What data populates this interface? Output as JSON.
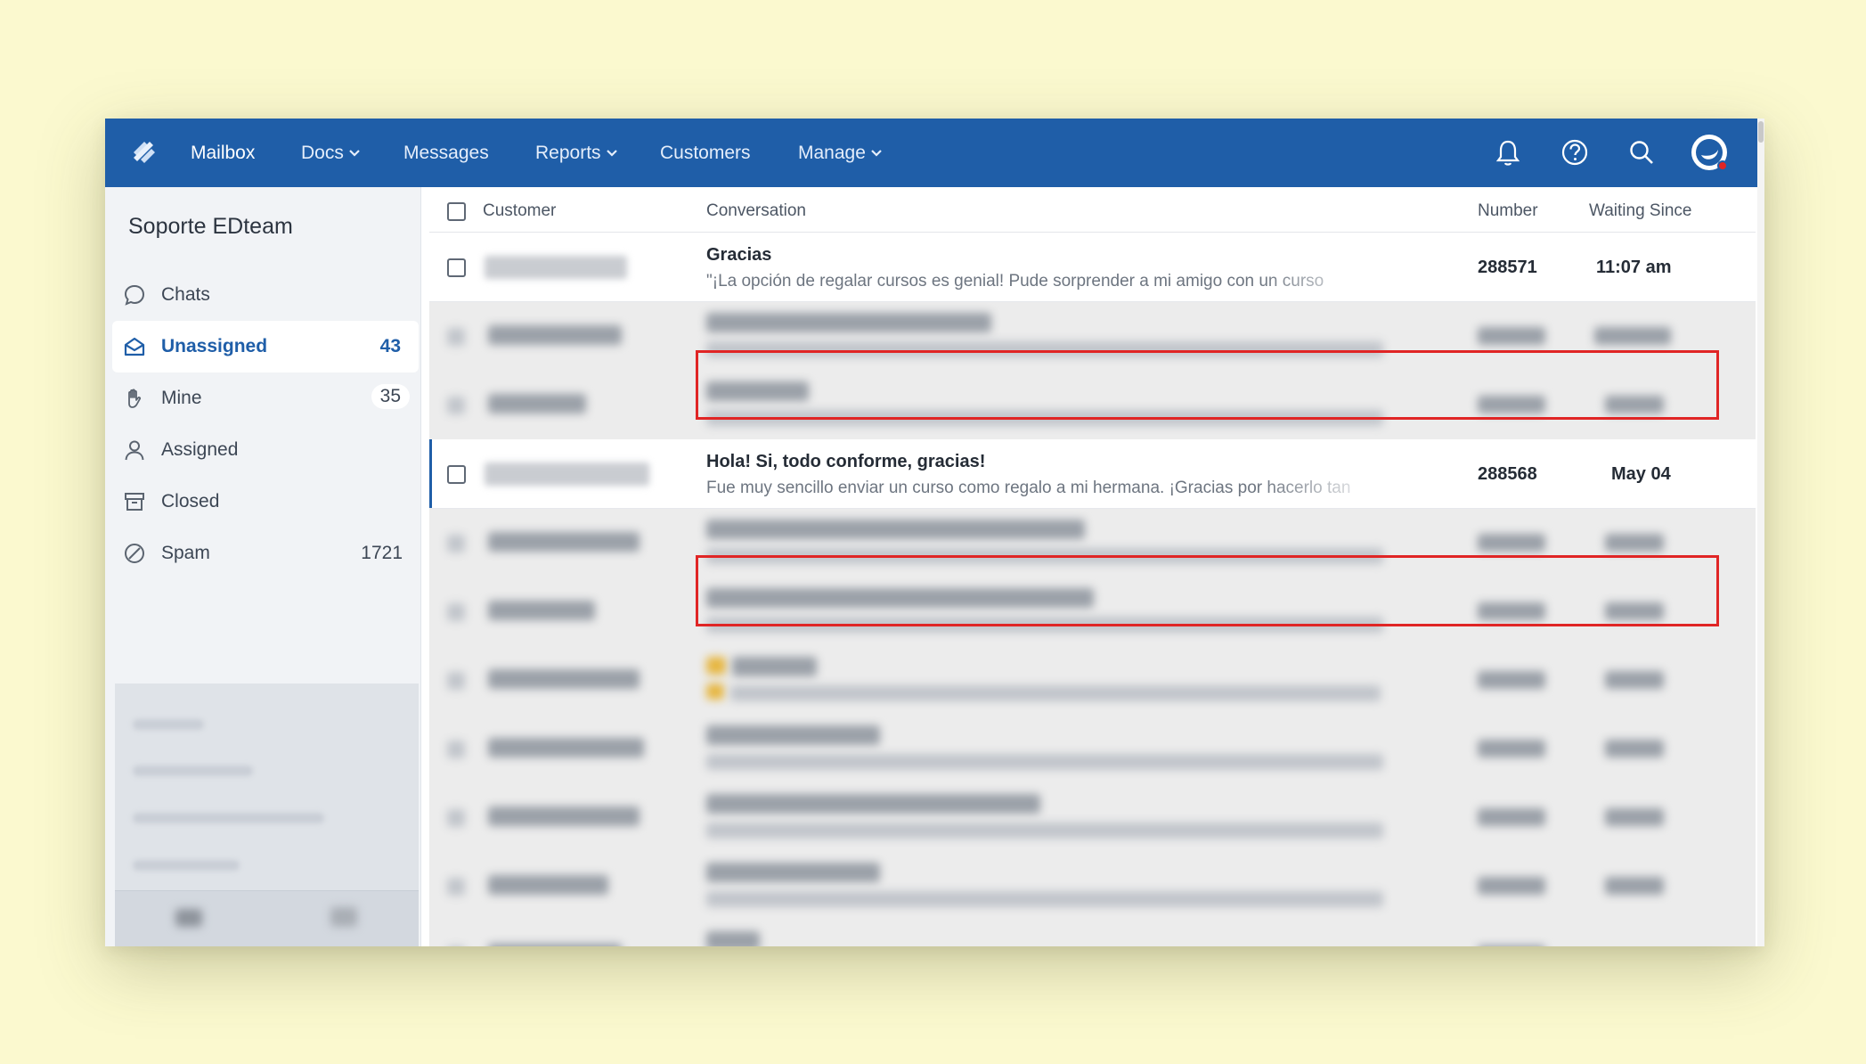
{
  "nav": {
    "items": [
      {
        "label": "Mailbox",
        "has_dropdown": false,
        "active": true
      },
      {
        "label": "Docs",
        "has_dropdown": true,
        "active": false
      },
      {
        "label": "Messages",
        "has_dropdown": false,
        "active": false
      },
      {
        "label": "Reports",
        "has_dropdown": true,
        "active": false
      },
      {
        "label": "Customers",
        "has_dropdown": false,
        "active": false
      },
      {
        "label": "Manage",
        "has_dropdown": true,
        "active": false
      }
    ],
    "icons": [
      "bell-icon",
      "help-icon",
      "search-icon",
      "avatar"
    ]
  },
  "sidebar": {
    "mailbox_name": "Soporte EDteam",
    "folders": [
      {
        "label": "Chats",
        "count": "",
        "icon": "chat-icon"
      },
      {
        "label": "Unassigned",
        "count": "43",
        "icon": "inbox-icon",
        "active": true
      },
      {
        "label": "Mine",
        "count": "35",
        "icon": "hand-icon"
      },
      {
        "label": "Assigned",
        "count": "",
        "icon": "person-icon"
      },
      {
        "label": "Closed",
        "count": "",
        "icon": "archive-icon"
      },
      {
        "label": "Spam",
        "count": "1721",
        "icon": "spam-icon"
      }
    ]
  },
  "list": {
    "columns": {
      "customer": "Customer",
      "conversation": "Conversation",
      "number": "Number",
      "waiting": "Waiting Since"
    },
    "conversations": [
      {
        "subject": "Gracias",
        "preview": "\"¡La opción de regalar cursos es genial! Pude sorprender a mi amigo con un curso",
        "number": "288571",
        "waiting_since": "11:07 am",
        "highlighted": true
      },
      {
        "subject": "Hola! Si, todo conforme, gracias!",
        "preview": "Fue muy sencillo enviar un curso como regalo a mi hermana. ¡Gracias por hacerlo tan",
        "number": "288568",
        "waiting_since": "May 04",
        "highlighted": true
      }
    ]
  },
  "colors": {
    "brand": "#1f5ea8",
    "highlight": "#e02525",
    "background": "#fbf9cf"
  }
}
